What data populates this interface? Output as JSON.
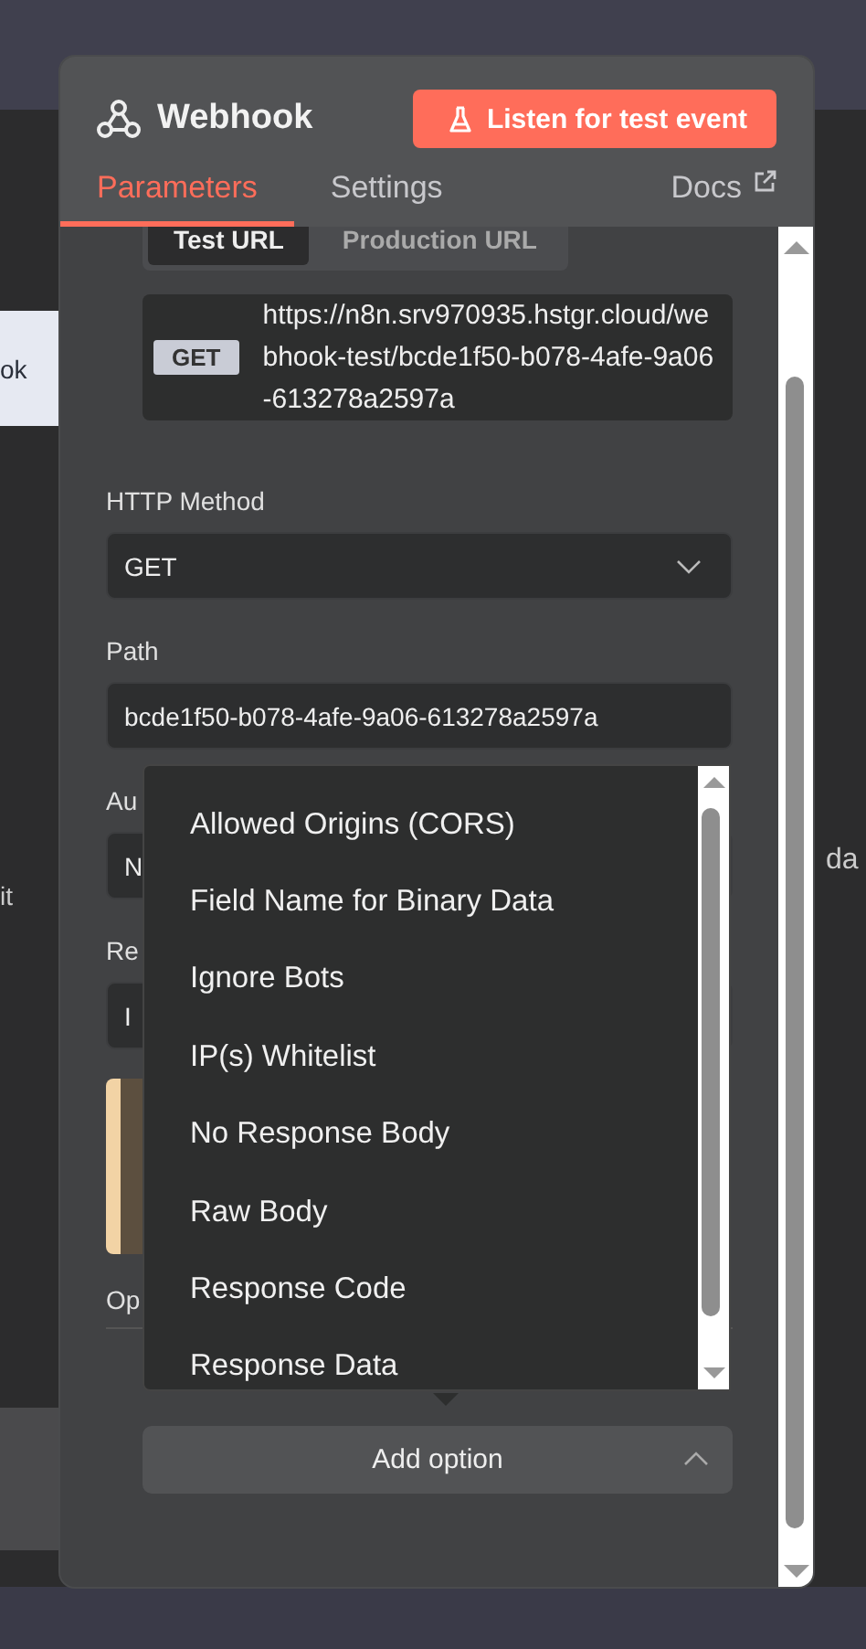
{
  "backdrop": {
    "tooltip_text": "ok",
    "left_text": "it",
    "right_text": "da"
  },
  "panel": {
    "title": "Webhook",
    "listen_button": "Listen for test event",
    "docs_link": "Docs",
    "tabs": [
      {
        "label": "Parameters",
        "selected": true
      },
      {
        "label": "Settings",
        "selected": false
      }
    ]
  },
  "url_toggle": [
    {
      "label": "Test URL",
      "selected": true
    },
    {
      "label": "Production URL",
      "selected": false
    }
  ],
  "webhook_url": {
    "method": "GET",
    "url": "https://n8n.srv970935.hstgr.cloud/webhook-test/bcde1f50-b078-4afe-9a06-613278a2597a"
  },
  "fields": [
    {
      "kind": "select",
      "label": "HTTP Method",
      "value": "GET"
    },
    {
      "kind": "input",
      "label": "Path",
      "value": "bcde1f50-b078-4afe-9a06-613278a2597a"
    },
    {
      "kind": "covered",
      "label": "Au",
      "value": "N"
    },
    {
      "kind": "covered",
      "label": "Re",
      "value": "I"
    }
  ],
  "options_label": "Op",
  "add_option": {
    "label": "Add option",
    "expanded": true
  },
  "option_menu": [
    "Allowed Origins (CORS)",
    "Field Name for Binary Data",
    "Ignore Bots",
    "IP(s) Whitelist",
    "No Response Body",
    "Raw Body",
    "Response Code",
    "Response Data"
  ]
}
